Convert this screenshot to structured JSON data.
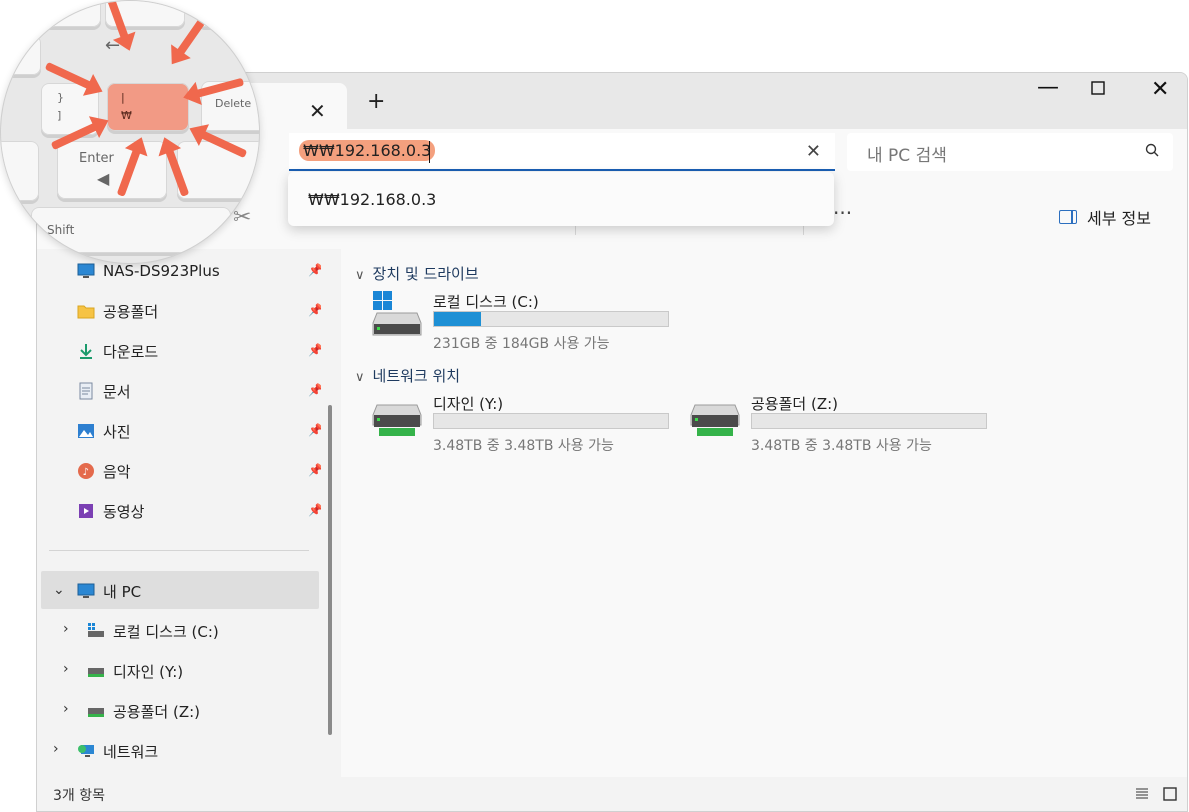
{
  "titlebar": {
    "new_tab_label": "+",
    "close_tab_symbol": "✕"
  },
  "address_bar": {
    "value": "₩₩192.168.0.3",
    "clear_symbol": "✕"
  },
  "search": {
    "placeholder": "내 PC 검색"
  },
  "dropdown": {
    "suggestion": "₩₩192.168.0.3"
  },
  "toolbar": {
    "more_label": "···",
    "details_label": "세부 정보"
  },
  "sidebar": {
    "quick_access": [
      {
        "label": "NAS-DS923Plus",
        "icon": "monitor-icon"
      },
      {
        "label": "공용폴더",
        "icon": "folder-icon"
      },
      {
        "label": "다운로드",
        "icon": "download-icon"
      },
      {
        "label": "문서",
        "icon": "document-icon"
      },
      {
        "label": "사진",
        "icon": "picture-icon"
      },
      {
        "label": "음악",
        "icon": "music-icon"
      },
      {
        "label": "동영상",
        "icon": "video-icon"
      }
    ],
    "this_pc": "내 PC",
    "drives": [
      {
        "label": "로컬 디스크 (C:)"
      },
      {
        "label": "디자인 (Y:)"
      },
      {
        "label": "공용폴더 (Z:)"
      }
    ],
    "network": "네트워크"
  },
  "content": {
    "section_devices": "장치 및 드라이브",
    "section_network": "네트워크 위치",
    "local_drive": {
      "name": "로컬 디스크 (C:)",
      "capacity": "231GB 중 184GB 사용 가능",
      "used_fraction": 0.2
    },
    "net_drives": [
      {
        "name": "디자인 (Y:)",
        "capacity": "3.48TB 중 3.48TB 사용 가능",
        "used_fraction": 0.0
      },
      {
        "name": "공용폴더 (Z:)",
        "capacity": "3.48TB 중 3.48TB 사용 가능",
        "used_fraction": 0.0
      }
    ]
  },
  "status": {
    "item_count": "3개 항목"
  },
  "keyboard_inset": {
    "key_backslash_top": "|",
    "key_backslash_bottom": "₩",
    "key_bracket_top": "}",
    "key_bracket_bottom": "]",
    "key_enter": "Enter",
    "key_delete": "Delete",
    "key_shift": "Shift"
  },
  "colors": {
    "accent": "#1a5fb4",
    "highlight": "#f4a07e",
    "drive_fill": "#1e90d5",
    "arrow": "#f0684d"
  }
}
